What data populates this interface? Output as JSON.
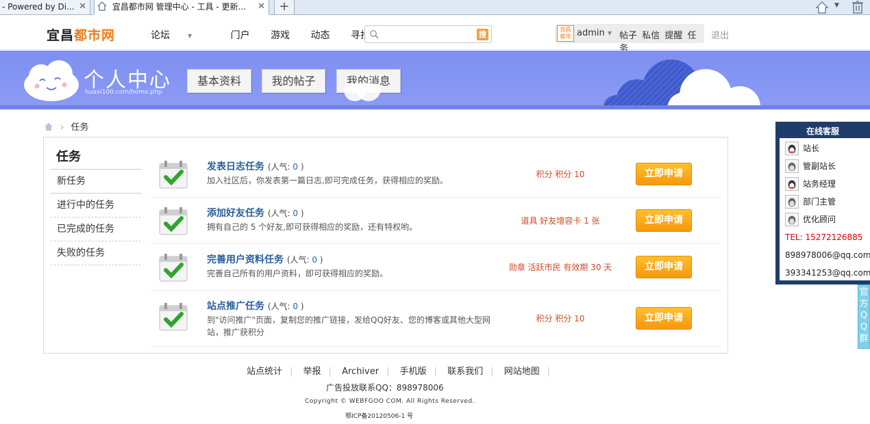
{
  "browser": {
    "tabs": [
      {
        "title": "- Powered by Di..."
      },
      {
        "title": "宜昌都市网 管理中心 - 工具 - 更新..."
      }
    ],
    "newtab_label": "+"
  },
  "topnav": {
    "logo_main": "宜昌",
    "logo_accent": "都市网",
    "links": [
      "论坛",
      "门户",
      "游戏",
      "动态",
      "寻找缘份"
    ],
    "search_button": "搜",
    "search_placeholder": "",
    "user_badge": "宜昌都市",
    "username": "admin",
    "user_links": [
      "帖子",
      "私信",
      "提醒",
      "任务"
    ],
    "logout": "退出"
  },
  "banner": {
    "title": "个人中心",
    "subtitle": "huaxi100.com/home.php",
    "buttons": [
      "基本资料",
      "我的帖子",
      "我的消息"
    ]
  },
  "breadcrumb": {
    "current": "任务"
  },
  "sidebar": {
    "title": "任务",
    "items": [
      "新任务",
      "进行中的任务",
      "已完成的任务",
      "失败的任务"
    ]
  },
  "tasks": [
    {
      "name": "发表日志任务",
      "pop_label": "(人气: ",
      "pop_value": "0",
      "pop_end": " )",
      "desc": "加入社区后，你发表第一篇日志,即可完成任务，获得相应的奖励。",
      "reward": "积分 积分 10",
      "button": "立即申请"
    },
    {
      "name": "添加好友任务",
      "pop_label": "(人气: ",
      "pop_value": "0",
      "pop_end": " )",
      "desc": "拥有自己的 5 个好友,即可获得相应的奖励，还有特权哟。",
      "reward": "道具 好友增容卡 1 张",
      "button": "立即申请"
    },
    {
      "name": "完善用户资料任务",
      "pop_label": "(人气: ",
      "pop_value": "0",
      "pop_end": " )",
      "desc": "完善自己所有的用户资料，即可获得相应的奖励。",
      "reward": "勋章 活跃市民 有效期 30 天",
      "button": "立即申请"
    },
    {
      "name": "站点推广任务",
      "pop_label": "(人气: ",
      "pop_value": "0",
      "pop_end": " )",
      "desc": "到\"访问推广\"页面，复制您的推广链接，发给QQ好友、您的博客或其他大型网站，推广获积分",
      "reward": "积分 积分 10",
      "button": "立即申请"
    }
  ],
  "footer": {
    "links": [
      "站点统计",
      "举报",
      "Archiver",
      "手机版",
      "联系我们",
      "网站地图"
    ],
    "ad": "广告投放联系QQ：898978006",
    "copyright": "Copyright © WEBFGOO COM. All Rights Reserved.",
    "icp": "鄂ICP备20120506-1 号"
  },
  "service": {
    "title": "在线客服",
    "staff": [
      "站长",
      "管副站长",
      "站务经理",
      "部门主管",
      "优化顾问"
    ],
    "tel": "TEL: 15272126885",
    "emails": [
      "898978006@qq.com",
      "393341253@qq.com"
    ],
    "side_tab_chars": [
      "官",
      "方",
      "Q",
      "Q",
      "群"
    ]
  },
  "colors": {
    "banner": "#8b9bf5",
    "accent_orange": "#f07b1c",
    "button_orange": "#f7980a",
    "link_blue": "#2a5f9c",
    "reward_red": "#d04a2a"
  }
}
